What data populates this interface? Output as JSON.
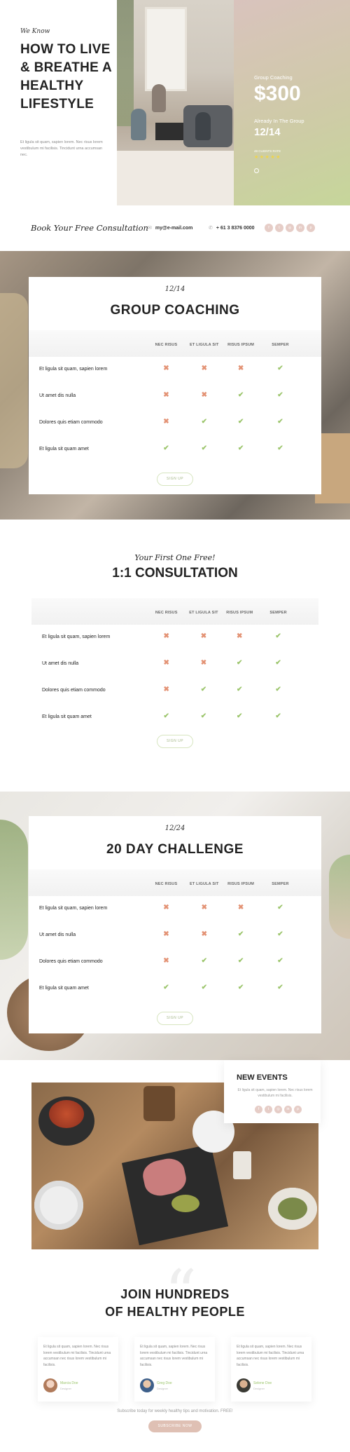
{
  "hero": {
    "tag": "We Know",
    "title": "HOW TO LIVE & BREATHE A HEALTHY LIFESTYLE",
    "text": "Et ligula sit quam, sapien lorem. Nec risus lorem vestibulum mi facilisis. Tincidunt urna accumsan nec.",
    "coaching_label": "Group Coaching",
    "price": "$300",
    "group_label": "Already In The Group",
    "group_count": "12/14",
    "rating_label": "48 CLIENTS RATE",
    "rating": 4.5
  },
  "contact": {
    "book": "Book Your Free Consultation",
    "email": "my@e-mail.com",
    "phone": "+ 61 3 8376 0000",
    "social_icons": [
      "facebook-icon",
      "twitter-icon",
      "instagram-icon",
      "linkedin-icon",
      "pinterest-icon"
    ]
  },
  "columns": [
    "NEC RISUS",
    "ET LIGULA SIT",
    "RISUS IPSUM",
    "SEMPER"
  ],
  "rows": [
    "Et ligula sit quam, sapien lorem",
    "Ut amet dis nulla",
    "Dolores quis etiam commodo",
    "Et ligula sit quam amet"
  ],
  "marks": [
    [
      "x",
      "x",
      "x",
      "c"
    ],
    [
      "x",
      "x",
      "c",
      "c"
    ],
    [
      "x",
      "c",
      "c",
      "c"
    ],
    [
      "c",
      "c",
      "c",
      "c"
    ]
  ],
  "plans": {
    "group": {
      "date": "12/14",
      "title": "GROUP COACHING",
      "signup": "SIGN UP"
    },
    "consult": {
      "tag": "Your First One Free!",
      "title": "1:1 CONSULTATION",
      "signup": "SIGN UP"
    },
    "challenge": {
      "date": "12/24",
      "title": "20 DAY CHALLENGE",
      "signup": "SIGN UP"
    }
  },
  "events": {
    "title": "NEW EVENTS",
    "text": "Et ligula sit quam, sapien lorem. Nec risus lorem vestibulum mi facilisis."
  },
  "testimonials": {
    "heading_line1": "JOIN HUNDREDS",
    "heading_line2": "OF HEALTHY PEOPLE",
    "items": [
      {
        "text": "Et ligula sit quam, sapien lorem. Nec risus lorem vestibulum mi facilisis. Tincidunt urna accumsan nec risus lorem vestibulum mi facilisis.",
        "name": "Marcia Doe",
        "role": "Designer"
      },
      {
        "text": "Et ligula sit quam, sapien lorem. Nec risus lorem vestibulum mi facilisis. Tincidunt urna accumsan nec risus lorem vestibulum mi facilisis.",
        "name": "Greg Doe",
        "role": "Designer"
      },
      {
        "text": "Et ligula sit quam, sapien lorem. Nec risus lorem vestibulum mi facilisis. Tincidunt urna accumsan nec risus lorem vestibulum mi facilisis.",
        "name": "Selene Doe",
        "role": "Designer"
      }
    ],
    "subscribe_text": "Subscribe today for weekly healthy tips and motivation. FREE!",
    "subscribe_button": "SUBSCRIBE NOW"
  },
  "colors": {
    "cross": "#e39274",
    "check": "#9cc56c",
    "accent": "#dfc0b4",
    "social": "#e6cdc7"
  }
}
